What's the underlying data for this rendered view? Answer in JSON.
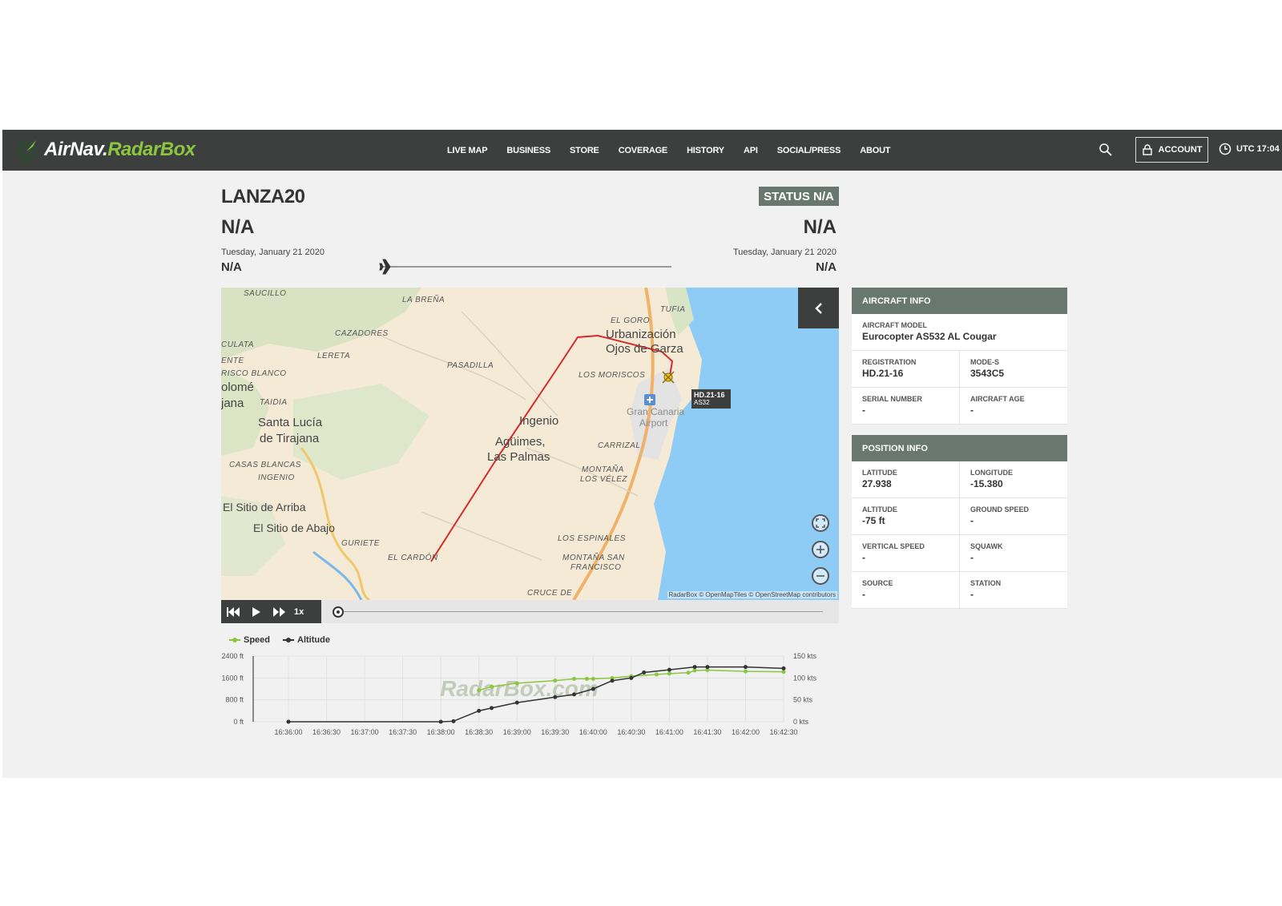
{
  "brand": {
    "name_white": "AirNav.",
    "name_green": "RadarBox"
  },
  "nav": {
    "items": [
      "LIVE MAP",
      "BUSINESS",
      "STORE",
      "COVERAGE",
      "HISTORY",
      "API",
      "SOCIAL/PRESS",
      "ABOUT"
    ],
    "account_label": "ACCOUNT",
    "utc_label": "UTC 17:04"
  },
  "flight": {
    "callsign": "LANZA20",
    "status": "STATUS N/A",
    "departure": {
      "code": "N/A",
      "date": "Tuesday, January 21 2020",
      "time": "N/A"
    },
    "arrival": {
      "code": "N/A",
      "date": "Tuesday, January 21 2020",
      "time": "N/A"
    }
  },
  "map": {
    "labels": {
      "saucillo": "SAUCILLO",
      "la_brena": "LA BREÑA",
      "tufia": "TUFIA",
      "el_goro": "EL GORO",
      "urbanizacion": "Urbanización",
      "ojos_de_garza": "Ojos de Garza",
      "cazadores": "CAZADORES",
      "culata": "CULATA",
      "lereta": "LERETA",
      "ente": "ENTE",
      "pasadilla": "PASADILLA",
      "risco_blanco": "RISCO BLANCO",
      "los_moriscos": "LOS MORISCOS",
      "olome": "olomé",
      "jana": "jana",
      "taidia": "TAIDIA",
      "santa_lucia": "Santa Lucía",
      "de_tirajana": "de Tirajana",
      "ingenio": "Ingenio",
      "agueimes": "Agüimes,",
      "las_palmas": "Las Palmas",
      "gran_canaria": "Gran Canaria",
      "airport": "Airport",
      "carrizal": "CARRIZAL",
      "casas_blancas": "CASAS BLANCAS",
      "ingenio_small": "INGENIO",
      "montana_los_velez": "MONTAÑA",
      "los_velez": "LOS VÉLEZ",
      "el_sitio_arriba": "El Sitio de Arriba",
      "el_sitio_abajo": "El Sitio de Abajo",
      "guriete": "GURIETE",
      "el_cardon": "EL CARDÓN",
      "los_espinales": "LOS ESPINALES",
      "montana_san": "MONTAÑA SAN",
      "francisco": "FRANCISCO",
      "cruce_de": "CRUCE DE"
    },
    "aircraft_tag": {
      "registration": "HD.21-16",
      "type": "AS32"
    },
    "attribution": "RadarBox © OpenMapTiles © OpenStreetMap contributors"
  },
  "playback": {
    "speed": "1x"
  },
  "aircraft_info": {
    "header": "AIRCRAFT INFO",
    "model_label": "AIRCRAFT MODEL",
    "model": "Eurocopter AS532 AL Cougar",
    "registration_label": "REGISTRATION",
    "registration": "HD.21-16",
    "modes_label": "MODE-S",
    "modes": "3543C5",
    "serial_label": "SERIAL NUMBER",
    "serial": "-",
    "age_label": "AIRCRAFT AGE",
    "age": "-"
  },
  "position_info": {
    "header": "POSITION INFO",
    "latitude_label": "LATITUDE",
    "latitude": "27.938",
    "longitude_label": "LONGITUDE",
    "longitude": "-15.380",
    "altitude_label": "ALTITUDE",
    "altitude": "-75 ft",
    "ground_speed_label": "GROUND SPEED",
    "ground_speed": "-",
    "vertical_speed_label": "VERTICAL SPEED",
    "vertical_speed": "-",
    "squawk_label": "SQUAWK",
    "squawk": "-",
    "source_label": "SOURCE",
    "source": "-",
    "station_label": "STATION",
    "station": "-"
  },
  "chart_data": {
    "type": "line",
    "watermark": "RadarBox.com",
    "x": [
      "16:36:00",
      "16:36:30",
      "16:37:00",
      "16:37:30",
      "16:38:00",
      "16:38:30",
      "16:39:00",
      "16:39:30",
      "16:40:00",
      "16:40:30",
      "16:41:00",
      "16:41:30",
      "16:42:00",
      "16:42:30"
    ],
    "y_left_ticks": [
      "2400 ft",
      "1600 ft",
      "800 ft",
      "0 ft"
    ],
    "y_right_ticks": [
      "150 kts",
      "100 kts",
      "50 kts",
      "0 kts"
    ],
    "y_left_lim": [
      0,
      2400
    ],
    "y_right_lim": [
      0,
      150
    ],
    "series": [
      {
        "name": "Speed",
        "axis": "right",
        "color": "#8cc63f",
        "points": [
          [
            "16:38:30",
            72
          ],
          [
            "16:38:40",
            80
          ],
          [
            "16:39:00",
            88
          ],
          [
            "16:39:30",
            94
          ],
          [
            "16:39:45",
            98
          ],
          [
            "16:39:55",
            98
          ],
          [
            "16:40:00",
            98
          ],
          [
            "16:40:15",
            100
          ],
          [
            "16:40:30",
            104
          ],
          [
            "16:40:50",
            108
          ],
          [
            "16:41:00",
            110
          ],
          [
            "16:41:15",
            112
          ],
          [
            "16:41:20",
            117
          ],
          [
            "16:41:30",
            118
          ],
          [
            "16:42:00",
            115
          ],
          [
            "16:42:30",
            114
          ]
        ]
      },
      {
        "name": "Altitude",
        "axis": "left",
        "color": "#333333",
        "points": [
          [
            "16:36:00",
            0
          ],
          [
            "16:38:00",
            0
          ],
          [
            "16:38:10",
            20
          ],
          [
            "16:38:30",
            400
          ],
          [
            "16:38:40",
            500
          ],
          [
            "16:39:00",
            700
          ],
          [
            "16:39:30",
            900
          ],
          [
            "16:39:45",
            1000
          ],
          [
            "16:40:00",
            1200
          ],
          [
            "16:40:15",
            1500
          ],
          [
            "16:40:30",
            1600
          ],
          [
            "16:40:40",
            1800
          ],
          [
            "16:41:00",
            1900
          ],
          [
            "16:41:20",
            2000
          ],
          [
            "16:41:30",
            2000
          ],
          [
            "16:42:00",
            2000
          ],
          [
            "16:42:30",
            1950
          ]
        ]
      }
    ]
  }
}
